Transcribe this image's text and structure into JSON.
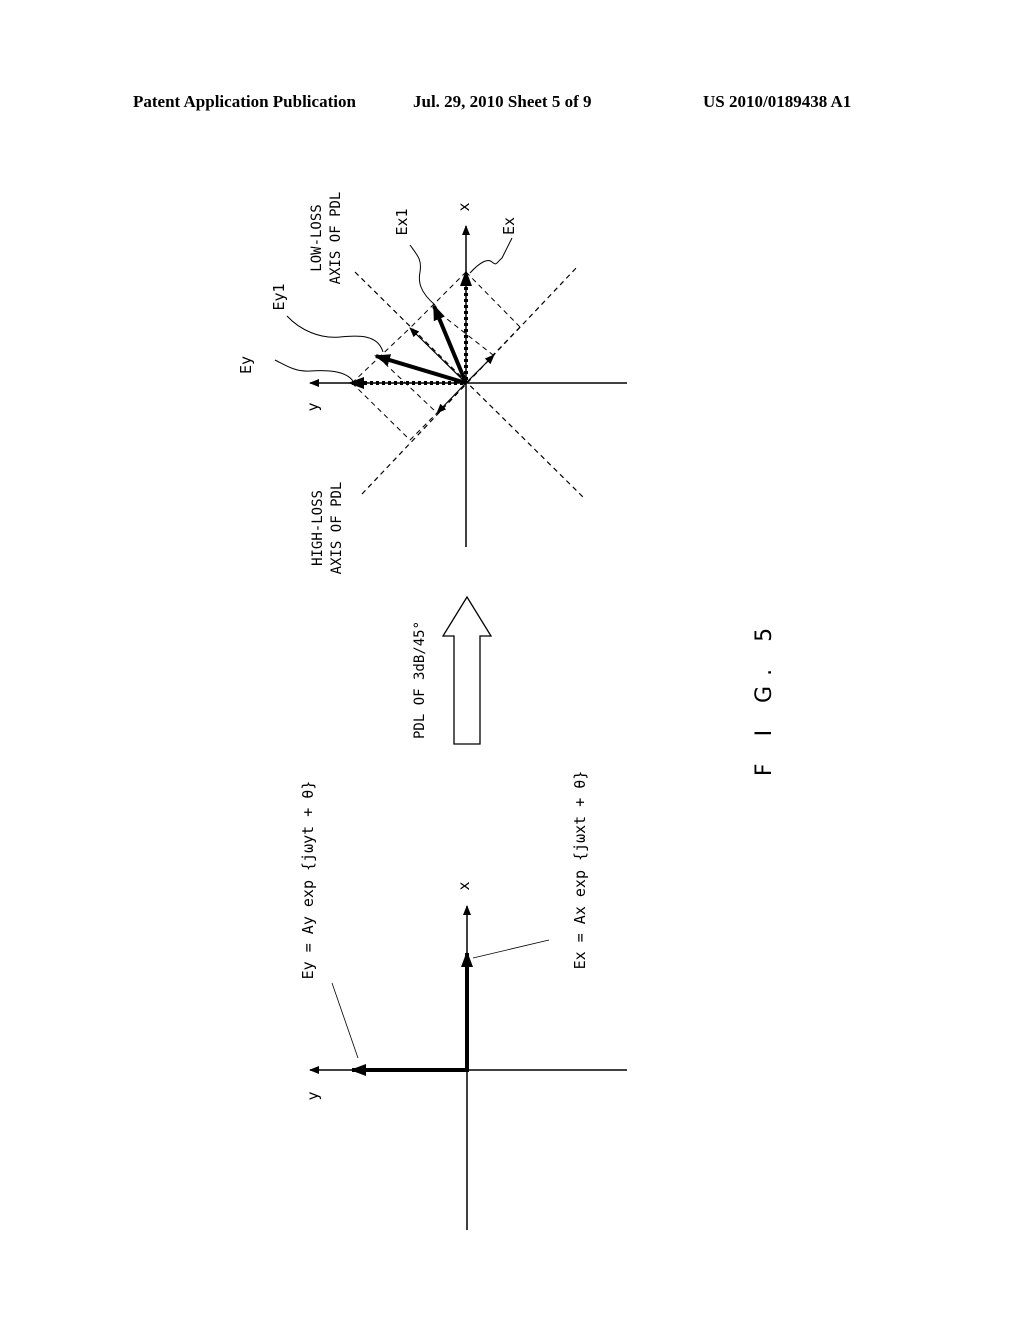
{
  "header": {
    "left": "Patent Application Publication",
    "middle": "Jul. 29, 2010   Sheet 5 of 9",
    "right": "US 2010/0189438 A1"
  },
  "figure": {
    "label": "F I G. 5",
    "transition_label": "PDL OF 3dB/45°",
    "before": {
      "axis_x": "x",
      "axis_y": "y",
      "ex_equation": "Ex = Ax exp {jωxt + θ}",
      "ey_equation": "Ey = Ay exp {jωyt + θ}"
    },
    "after": {
      "axis_x": "x",
      "axis_y": "y",
      "ex": "Ex",
      "ey": "Ey",
      "ex1": "Ex1",
      "ey1": "Ey1",
      "low_loss_line1": "LOW-LOSS",
      "low_loss_line2": "AXIS OF PDL",
      "high_loss_line1": "HIGH-LOSS",
      "high_loss_line2": "AXIS OF PDL"
    }
  }
}
